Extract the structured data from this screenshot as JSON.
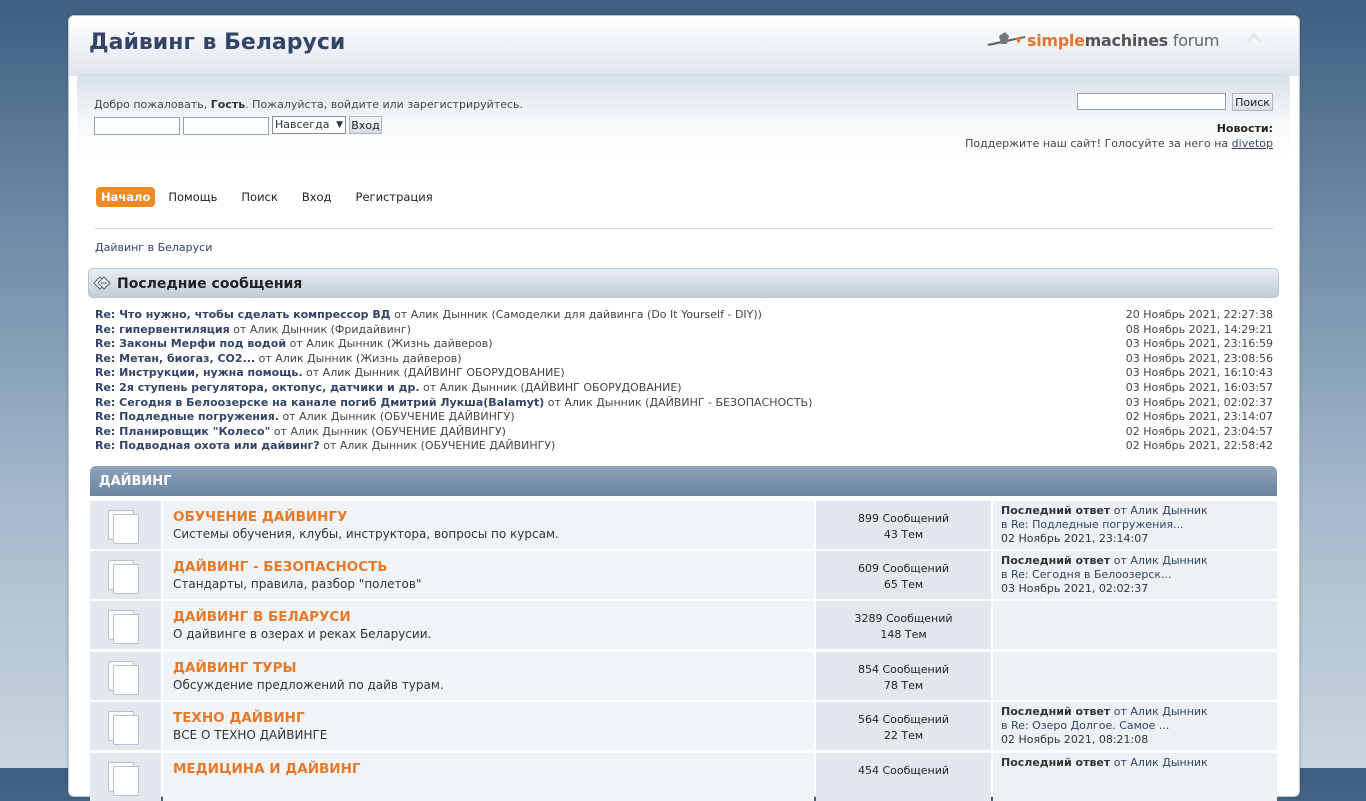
{
  "header": {
    "forum_name": "Дайвинг в Беларуси",
    "logo": {
      "part1": "simple",
      "part2": "machines",
      "part3": "forum"
    },
    "collapse_icon": "chevron-up-icon"
  },
  "user": {
    "welcome_prefix": "Добро пожаловать,",
    "guest": "Гость",
    "welcome_suffix": ". Пожалуйста, войдите или зарегистрируйтесь.",
    "login_username_value": "",
    "login_password_value": "",
    "cookie_length_selected": "Навсегда",
    "login_button": "Вход"
  },
  "search": {
    "input_value": "",
    "button": "Поиск"
  },
  "news": {
    "title": "Новости:",
    "text": "Поддержите наш сайт! Голосуйте за него на",
    "link": "divetop"
  },
  "menu": {
    "items": [
      {
        "label": "Начало",
        "active": true
      },
      {
        "label": "Помощь"
      },
      {
        "label": "Поиск"
      },
      {
        "label": "Вход"
      },
      {
        "label": "Регистрация"
      }
    ]
  },
  "breadcrumb": "Дайвинг в Беларуси",
  "recent": {
    "title": "Последние сообщения",
    "posts": [
      {
        "subject": "Re: Что нужно, чтобы сделать компрессор ВД",
        "by": "от Алик Дынник (Самоделки для дайвинга (Do It Yourself - DIY))",
        "time": "20 Ноябрь 2021, 22:27:38"
      },
      {
        "subject": "Re: гипервентиляция",
        "by": "от Алик Дынник (Фридайвинг)",
        "time": "08 Ноябрь 2021, 14:29:21"
      },
      {
        "subject": "Re: Законы Мерфи под водой",
        "by": "от Алик Дынник (Жизнь дайверов)",
        "time": "03 Ноябрь 2021, 23:16:59"
      },
      {
        "subject": "Re: Метан, биогаз, CO2...",
        "by": "от Алик Дынник (Жизнь дайверов)",
        "time": "03 Ноябрь 2021, 23:08:56"
      },
      {
        "subject": "Re: Инструкции, нужна помощь.",
        "by": "от Алик Дынник (ДАЙВИНГ ОБОРУДОВАНИЕ)",
        "time": "03 Ноябрь 2021, 16:10:43"
      },
      {
        "subject": "Re: 2я ступень регулятора, октопус, датчики и др.",
        "by": "от Алик Дынник (ДАЙВИНГ ОБОРУДОВАНИЕ)",
        "time": "03 Ноябрь 2021, 16:03:57"
      },
      {
        "subject": "Re: Сегодня в Белоозерске на канале погиб Дмитрий Лукша(Balamyt)",
        "by": "от Алик Дынник (ДАЙВИНГ - БЕЗОПАСНОСТЬ)",
        "time": "03 Ноябрь 2021, 02:02:37"
      },
      {
        "subject": "Re: Подледные погружения.",
        "by": "от Алик Дынник (ОБУЧЕНИЕ ДАЙВИНГУ)",
        "time": "02 Ноябрь 2021, 23:14:07"
      },
      {
        "subject": "Re: Планировщик \"Колесо\"",
        "by": "от Алик Дынник (ОБУЧЕНИЕ ДАЙВИНГУ)",
        "time": "02 Ноябрь 2021, 23:04:57"
      },
      {
        "subject": "Re: Подводная охота или дайвинг?",
        "by": "от Алик Дынник (ОБУЧЕНИЕ ДАЙВИНГУ)",
        "time": "02 Ноябрь 2021, 22:58:42"
      }
    ]
  },
  "category": {
    "title": "ДАЙВИНГ",
    "boards": [
      {
        "name": "ОБУЧЕНИЕ ДАЙВИНГУ",
        "desc": "Системы обучения, клубы, инструктора, вопросы по курсам.",
        "posts": "899 Сообщений",
        "topics": "43 Тем",
        "last_label": "Последний ответ",
        "last_by": "от Алик Дынник",
        "last_in": "в Re: Подледные погружения...",
        "last_time": "02 Ноябрь 2021, 23:14:07"
      },
      {
        "name": "ДАЙВИНГ - БЕЗОПАСНОСТЬ",
        "desc": "Стандарты, правила, разбор \"полетов\"",
        "posts": "609 Сообщений",
        "topics": "65 Тем",
        "last_label": "Последний ответ",
        "last_by": "от Алик Дынник",
        "last_in": "в Re: Сегодня в Белоозерск...",
        "last_time": "03 Ноябрь 2021, 02:02:37"
      },
      {
        "name": "ДАЙВИНГ В БЕЛАРУСИ",
        "desc": "О дайвинге в озерах и реках Беларусии.",
        "posts": "3289 Сообщений",
        "topics": "148 Тем"
      },
      {
        "name": "ДАЙВИНГ ТУРЫ",
        "desc": "Обсуждение предложений по дайв турам.",
        "posts": "854 Сообщений",
        "topics": "78 Тем"
      },
      {
        "name": "ТЕХНО ДАЙВИНГ",
        "desc": "ВСЕ О ТЕХНО ДАЙВИНГЕ",
        "posts": "564 Сообщений",
        "topics": "22 Тем",
        "last_label": "Последний ответ",
        "last_by": "от Алик Дынник",
        "last_in": "в Re: Озеро Долгое. Самое ...",
        "last_time": "02 Ноябрь 2021, 08:21:08"
      },
      {
        "name": "МЕДИЦИНА И ДАЙВИНГ",
        "desc": "",
        "posts": "454 Сообщений",
        "topics": "",
        "last_label": "Последний ответ",
        "last_by": "от Алик Дынник",
        "last_in": "",
        "last_time": ""
      }
    ]
  }
}
